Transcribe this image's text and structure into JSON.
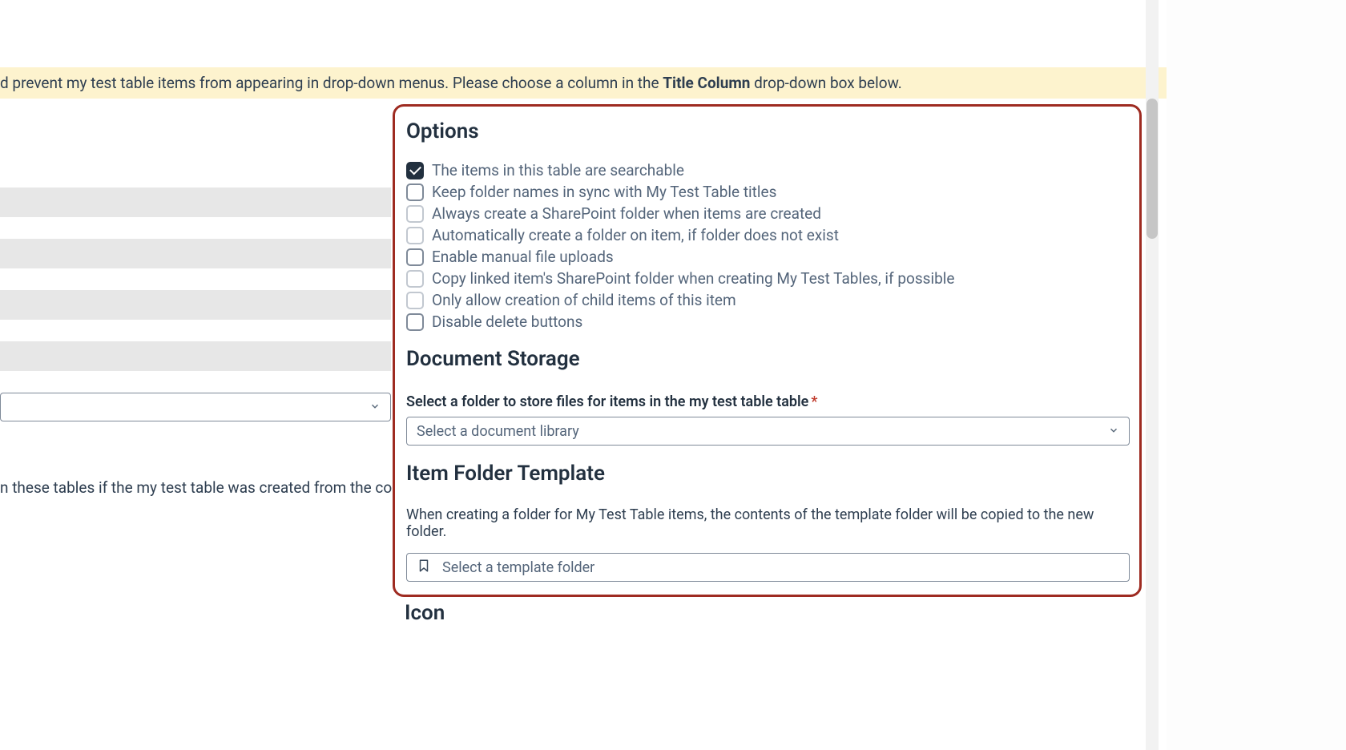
{
  "notice": {
    "pre": "d prevent my test table items from appearing in drop-down menus. Please choose a column in the ",
    "bold": "Title Column",
    "post": " drop-down box below."
  },
  "left_para": "n these tables if the my test table was created from the context of",
  "panel": {
    "options_heading": "Options",
    "checks": [
      {
        "label": "The items in this table are searchable",
        "checked": true,
        "style": "dark"
      },
      {
        "label": "Keep folder names in sync with My Test Table titles",
        "checked": false,
        "style": "dark"
      },
      {
        "label": "Always create a SharePoint folder when items are created",
        "checked": false,
        "style": "light"
      },
      {
        "label": "Automatically create a folder on item, if folder does not exist",
        "checked": false,
        "style": "light"
      },
      {
        "label": "Enable manual file uploads",
        "checked": false,
        "style": "dark"
      },
      {
        "label": "Copy linked item's SharePoint folder when creating My Test Tables, if possible",
        "checked": false,
        "style": "light"
      },
      {
        "label": "Only allow creation of child items of this item",
        "checked": false,
        "style": "light"
      },
      {
        "label": "Disable delete buttons",
        "checked": false,
        "style": "dark"
      }
    ],
    "doc_storage_heading": "Document Storage",
    "doc_storage_label": "Select a folder to store files for items in the my test table table",
    "doc_storage_placeholder": "Select a document library",
    "folder_template_heading": "Item Folder Template",
    "folder_template_desc": "When creating a folder for My Test Table items, the contents of the template folder will be copied to the new folder.",
    "folder_template_placeholder": "Select a template folder"
  },
  "icon_heading": "Icon"
}
